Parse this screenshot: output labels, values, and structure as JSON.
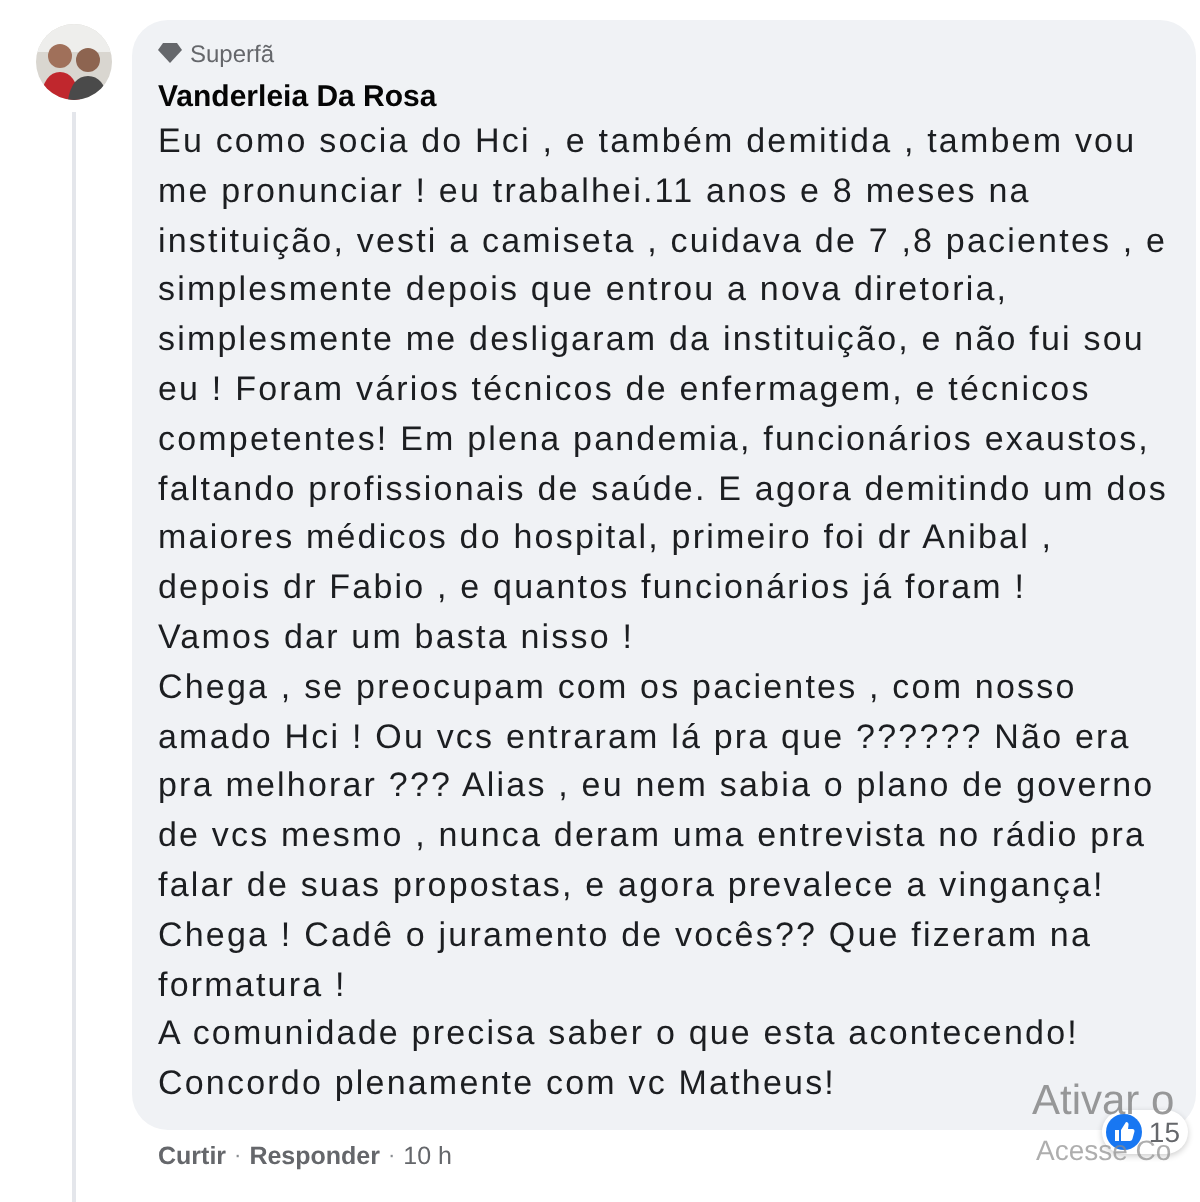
{
  "comment": {
    "badge": "Superfã",
    "author": "Vanderleia Da Rosa",
    "paragraphs": [
      "Eu como socia do Hci , e também demitida , tambem vou me pronunciar ! eu trabalhei.11 anos e 8 meses na instituição, vesti a camiseta , cuidava de 7 ,8 pacientes , e simplesmente depois que entrou a nova diretoria, simplesmente me desligaram da instituição, e não fui sou eu ! Foram vários técnicos de enfermagem, e técnicos competentes! Em plena pandemia, funcionários exaustos, faltando profissionais de saúde. E agora demitindo um dos maiores médicos do hospital, primeiro foi dr Anibal , depois dr Fabio , e quantos funcionários já foram !",
      "Vamos dar um basta nisso !",
      "Chega , se preocupam com os pacientes , com nosso amado Hci ! Ou vcs entraram lá pra que ?????? Não era pra melhorar ??? Alias , eu nem sabia o plano de governo de vcs mesmo , nunca deram uma entrevista no rádio pra falar de suas propostas, e agora prevalece a vingança!",
      "Chega ! Cadê o juramento de vocês?? Que fizeram na formatura !",
      "A comunidade precisa saber o que esta acontecendo!",
      "Concordo plenamente com vc Matheus!"
    ],
    "reactions": {
      "count": "15"
    },
    "actions": [
      {
        "kind": "link",
        "label": "Curtir"
      },
      {
        "kind": "sep",
        "label": "·"
      },
      {
        "kind": "link",
        "label": "Responder"
      },
      {
        "kind": "sep",
        "label": "·"
      },
      {
        "kind": "time",
        "label": "10 h"
      }
    ]
  },
  "activation_notice": {
    "lines": [
      "Ativar o",
      "Acesse Co"
    ]
  }
}
